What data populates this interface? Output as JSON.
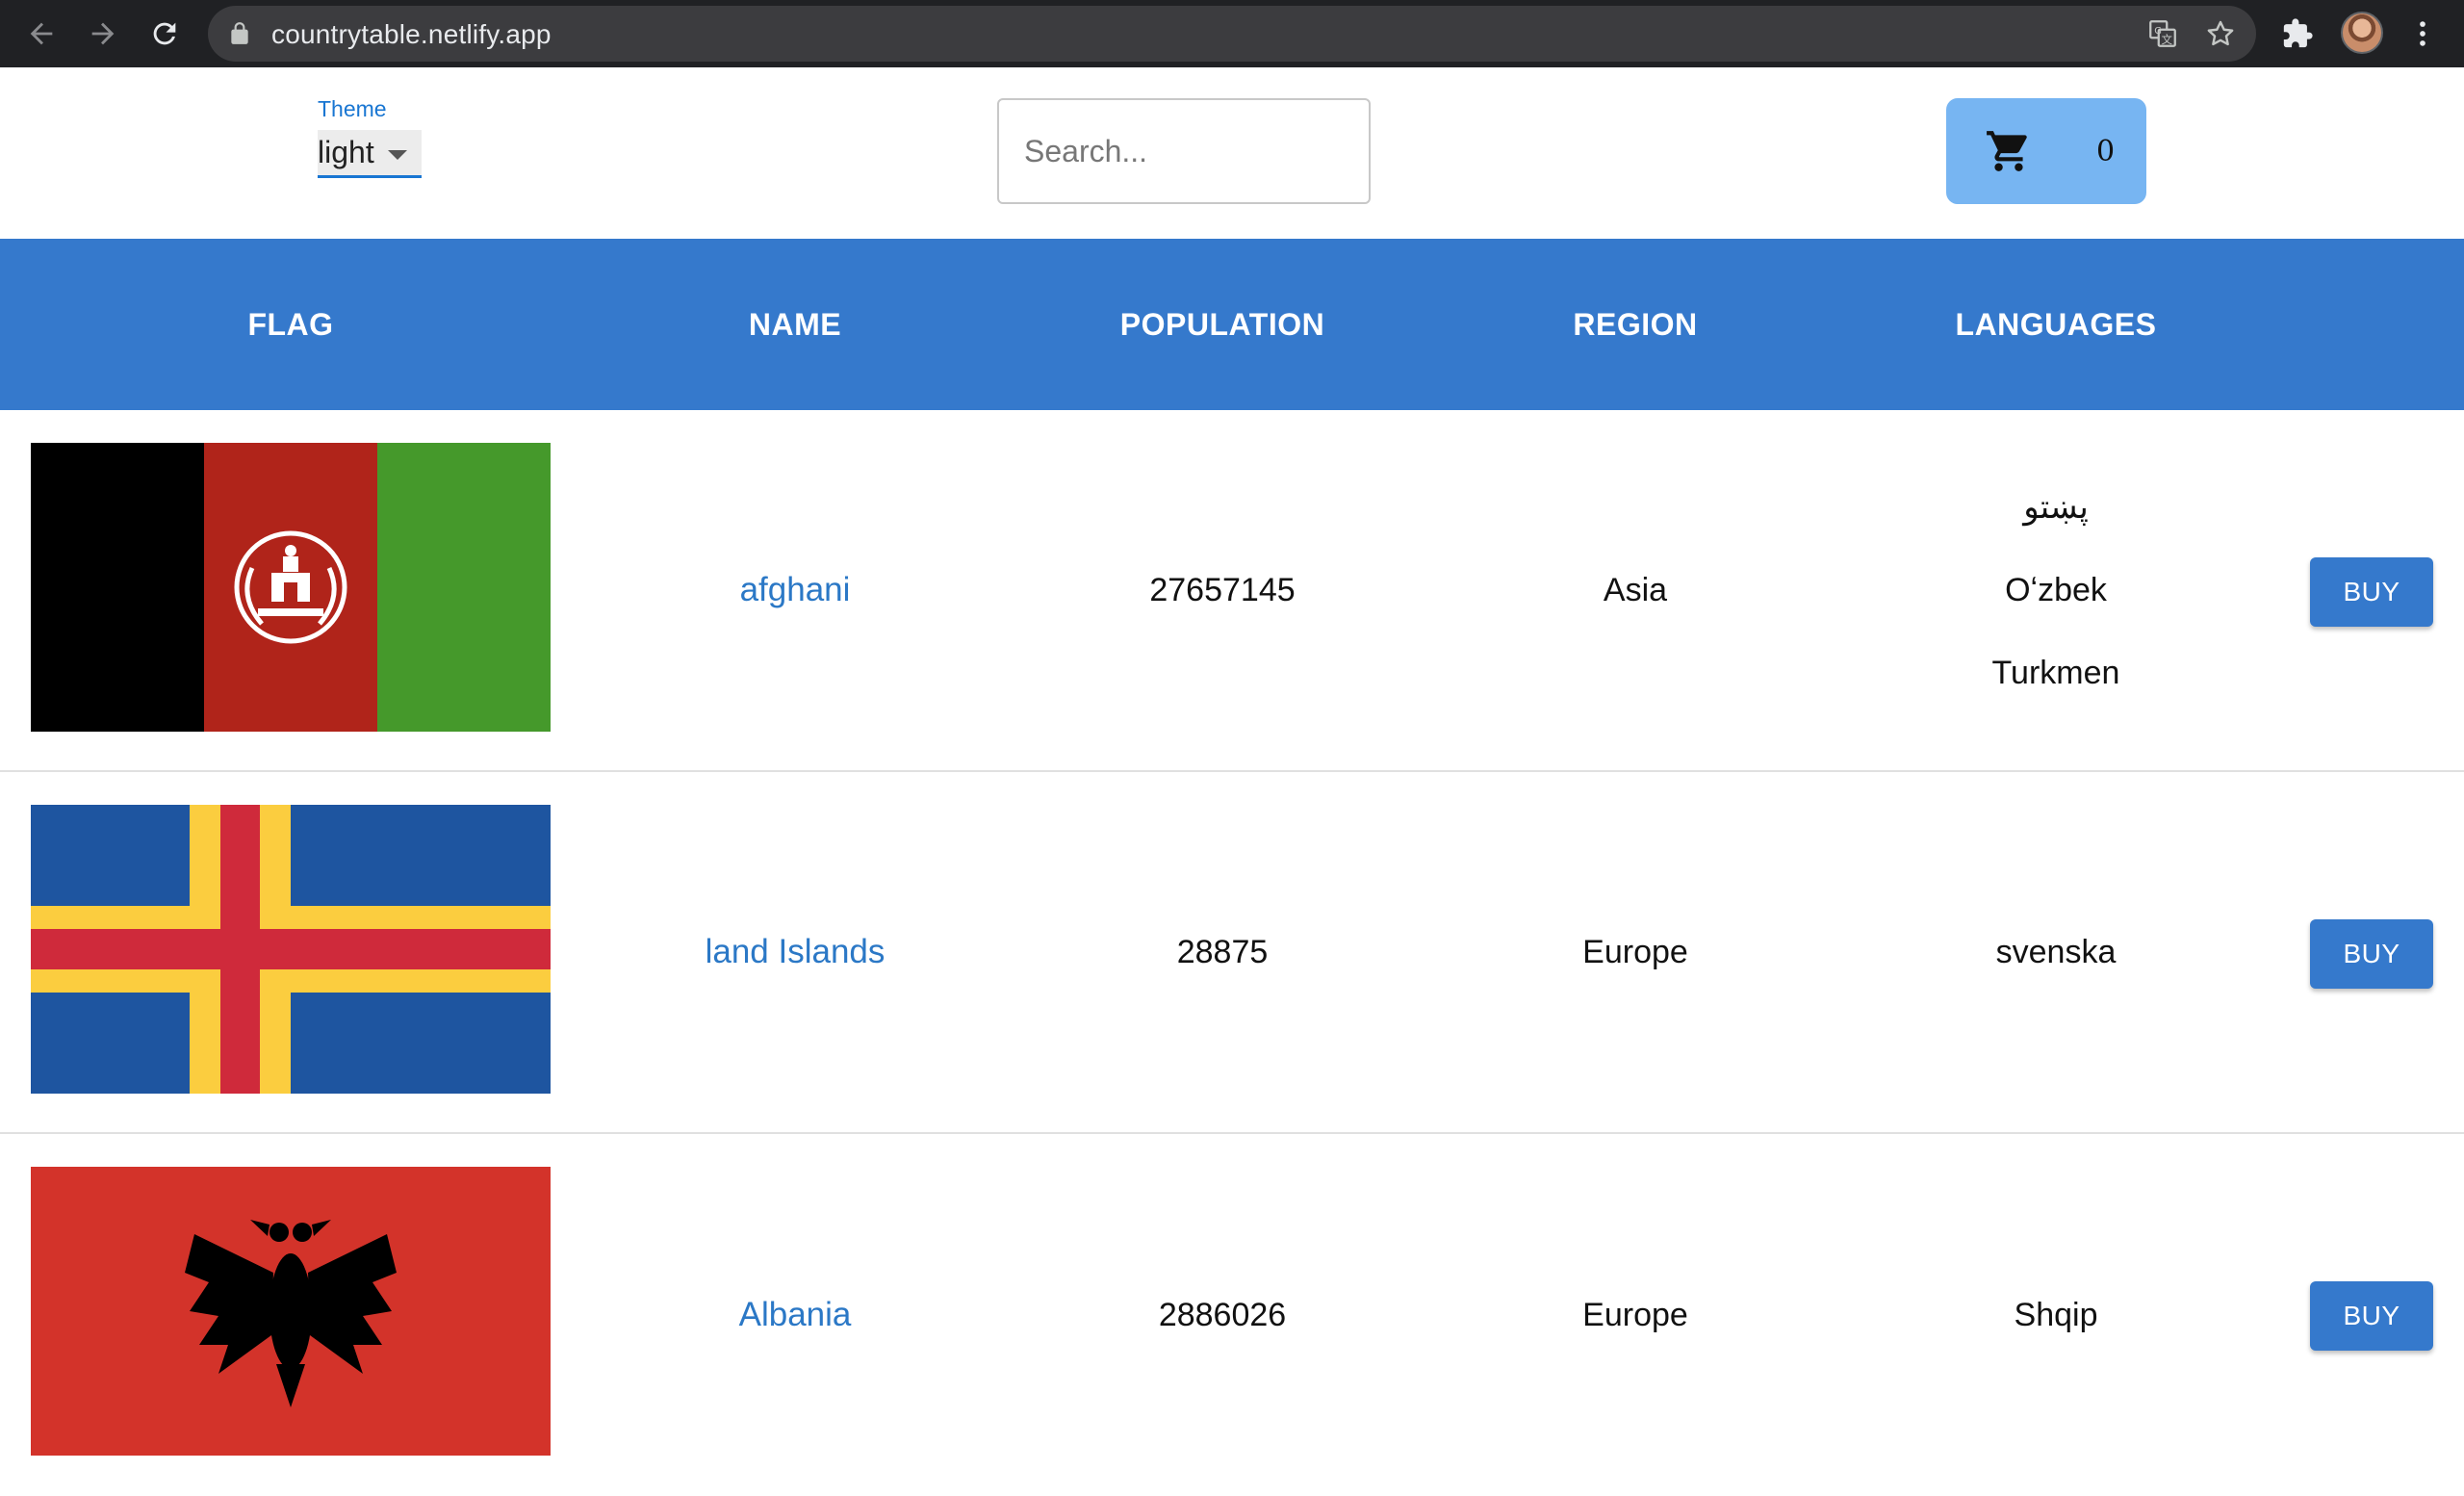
{
  "browser": {
    "url": "countrytable.netlify.app"
  },
  "header": {
    "theme_label": "Theme",
    "theme_value": "light",
    "search_placeholder": "Search...",
    "cart_count": "0"
  },
  "table": {
    "columns": [
      "FLAG",
      "NAME",
      "POPULATION",
      "REGION",
      "LANGUAGES"
    ],
    "buy_label": "BUY",
    "rows": [
      {
        "name": "afghani",
        "population": "27657145",
        "region": "Asia",
        "languages": [
          "پښتو",
          "Oʻzbek",
          "Turkmen"
        ],
        "flag": "afghanistan-flag"
      },
      {
        "name": "land Islands",
        "population": "28875",
        "region": "Europe",
        "languages": [
          "svenska"
        ],
        "flag": "aland-flag"
      },
      {
        "name": "Albania",
        "population": "2886026",
        "region": "Europe",
        "languages": [
          "Shqip"
        ],
        "flag": "albania-flag"
      }
    ]
  },
  "colors": {
    "accent": "#3579cc",
    "cart": "#77b5f2",
    "link": "#2b78c6"
  }
}
